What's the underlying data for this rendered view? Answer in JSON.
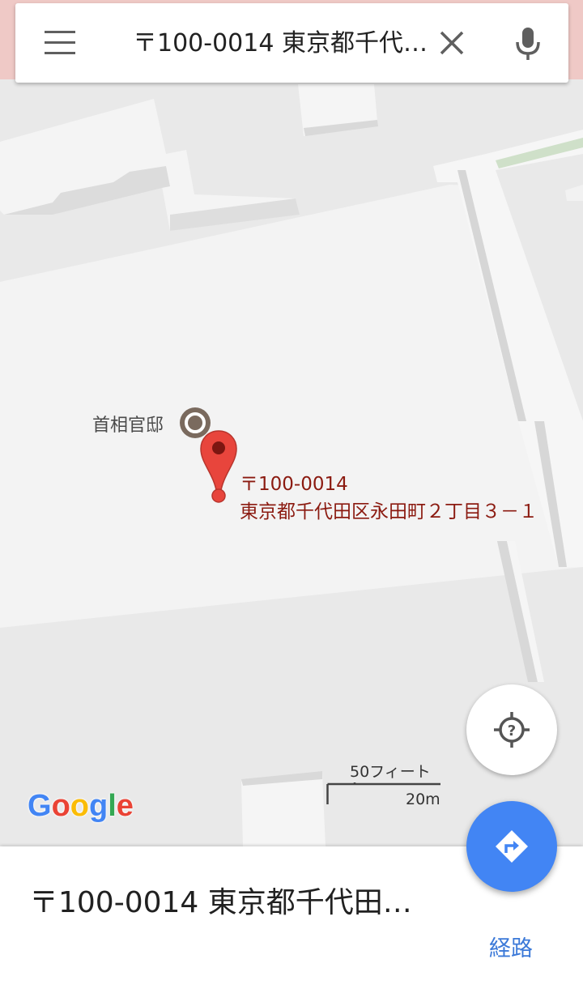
{
  "search": {
    "query": "〒100-0014 東京都千代…",
    "menu_icon": "hamburger-menu-icon",
    "clear_icon": "close-icon",
    "mic_icon": "microphone-icon"
  },
  "map": {
    "poi_label": "首相官邸",
    "poi_icon": "landmark-ring-icon",
    "marker_icon": "red-map-pin-icon",
    "pin_color": "#e8453c",
    "address_lines": [
      "〒100-0014",
      "東京都千代田区永田町２丁目３－１"
    ],
    "address_color": "#8b1a10",
    "logo": "Google",
    "scale": {
      "imperial": "50フィート",
      "metric": "20m"
    },
    "locate_icon": "locate-question-icon"
  },
  "bottom_sheet": {
    "title": "〒100-0014 東京都千代田…",
    "route_label": "経路",
    "directions_icon": "directions-arrow-icon",
    "accent_color": "#4285f4"
  }
}
